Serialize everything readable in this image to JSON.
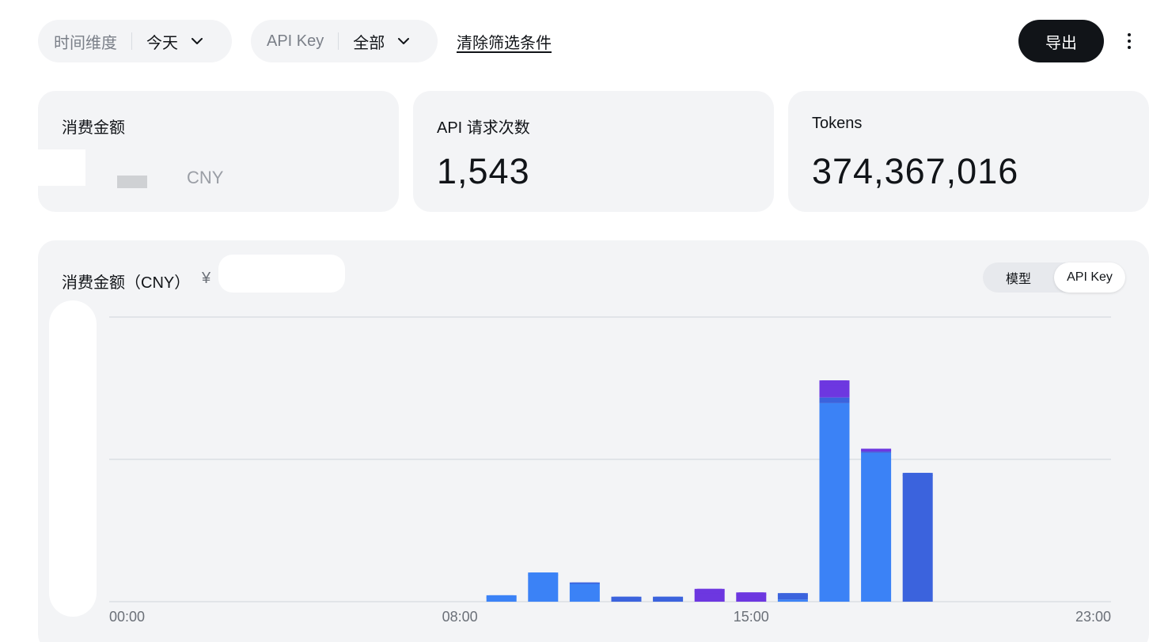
{
  "filters": {
    "time_label": "时间维度",
    "time_value": "今天",
    "key_label": "API Key",
    "key_value": "全部",
    "clear_label": "清除筛选条件"
  },
  "toolbar": {
    "export_label": "导出"
  },
  "stats": {
    "cost": {
      "title": "消费金额",
      "unit": "CNY"
    },
    "requests": {
      "title": "API 请求次数",
      "value": "1,543"
    },
    "tokens": {
      "title": "Tokens",
      "value": "374,367,016"
    }
  },
  "chart_panel": {
    "title": "消费金额（CNY）",
    "currency_symbol": "¥",
    "toggle": {
      "model_label": "模型",
      "key_label": "API Key",
      "selected": "API Key"
    }
  },
  "colors": {
    "bar_blue": "#3b82f6",
    "bar_blue_dark": "#3b63dd",
    "bar_purple": "#6d37e0",
    "grid": "#cfd3da",
    "axis_text": "#6b7078"
  },
  "chart_data": {
    "type": "bar",
    "stacked": true,
    "x_tick_labels": [
      "00:00",
      "08:00",
      "15:00",
      "23:00"
    ],
    "categories": [
      "00:00",
      "01:00",
      "02:00",
      "03:00",
      "04:00",
      "05:00",
      "06:00",
      "07:00",
      "08:00",
      "09:00",
      "10:00",
      "11:00",
      "12:00",
      "13:00",
      "14:00",
      "15:00",
      "16:00",
      "17:00",
      "18:00",
      "19:00",
      "20:00",
      "21:00",
      "22:00",
      "23:00"
    ],
    "ylim": [
      0,
      2
    ],
    "grid": true,
    "series": [
      {
        "color": "#3b82f6",
        "values": [
          0,
          0,
          0,
          0,
          0,
          0,
          0,
          0,
          0,
          0.045,
          0.205,
          0.125,
          0,
          0,
          0,
          0,
          0.015,
          1.395,
          1.045,
          0,
          0,
          0,
          0,
          0
        ]
      },
      {
        "color": "#3b63dd",
        "values": [
          0,
          0,
          0,
          0,
          0,
          0,
          0,
          0,
          0,
          0,
          0,
          0.01,
          0.035,
          0.035,
          0,
          0,
          0.045,
          0.04,
          0.01,
          0.905,
          0,
          0,
          0,
          0
        ]
      },
      {
        "color": "#6d37e0",
        "values": [
          0,
          0,
          0,
          0,
          0,
          0,
          0,
          0,
          0,
          0,
          0,
          0,
          0,
          0,
          0.09,
          0.065,
          0,
          0.12,
          0.02,
          0,
          0,
          0,
          0,
          0
        ]
      }
    ]
  }
}
